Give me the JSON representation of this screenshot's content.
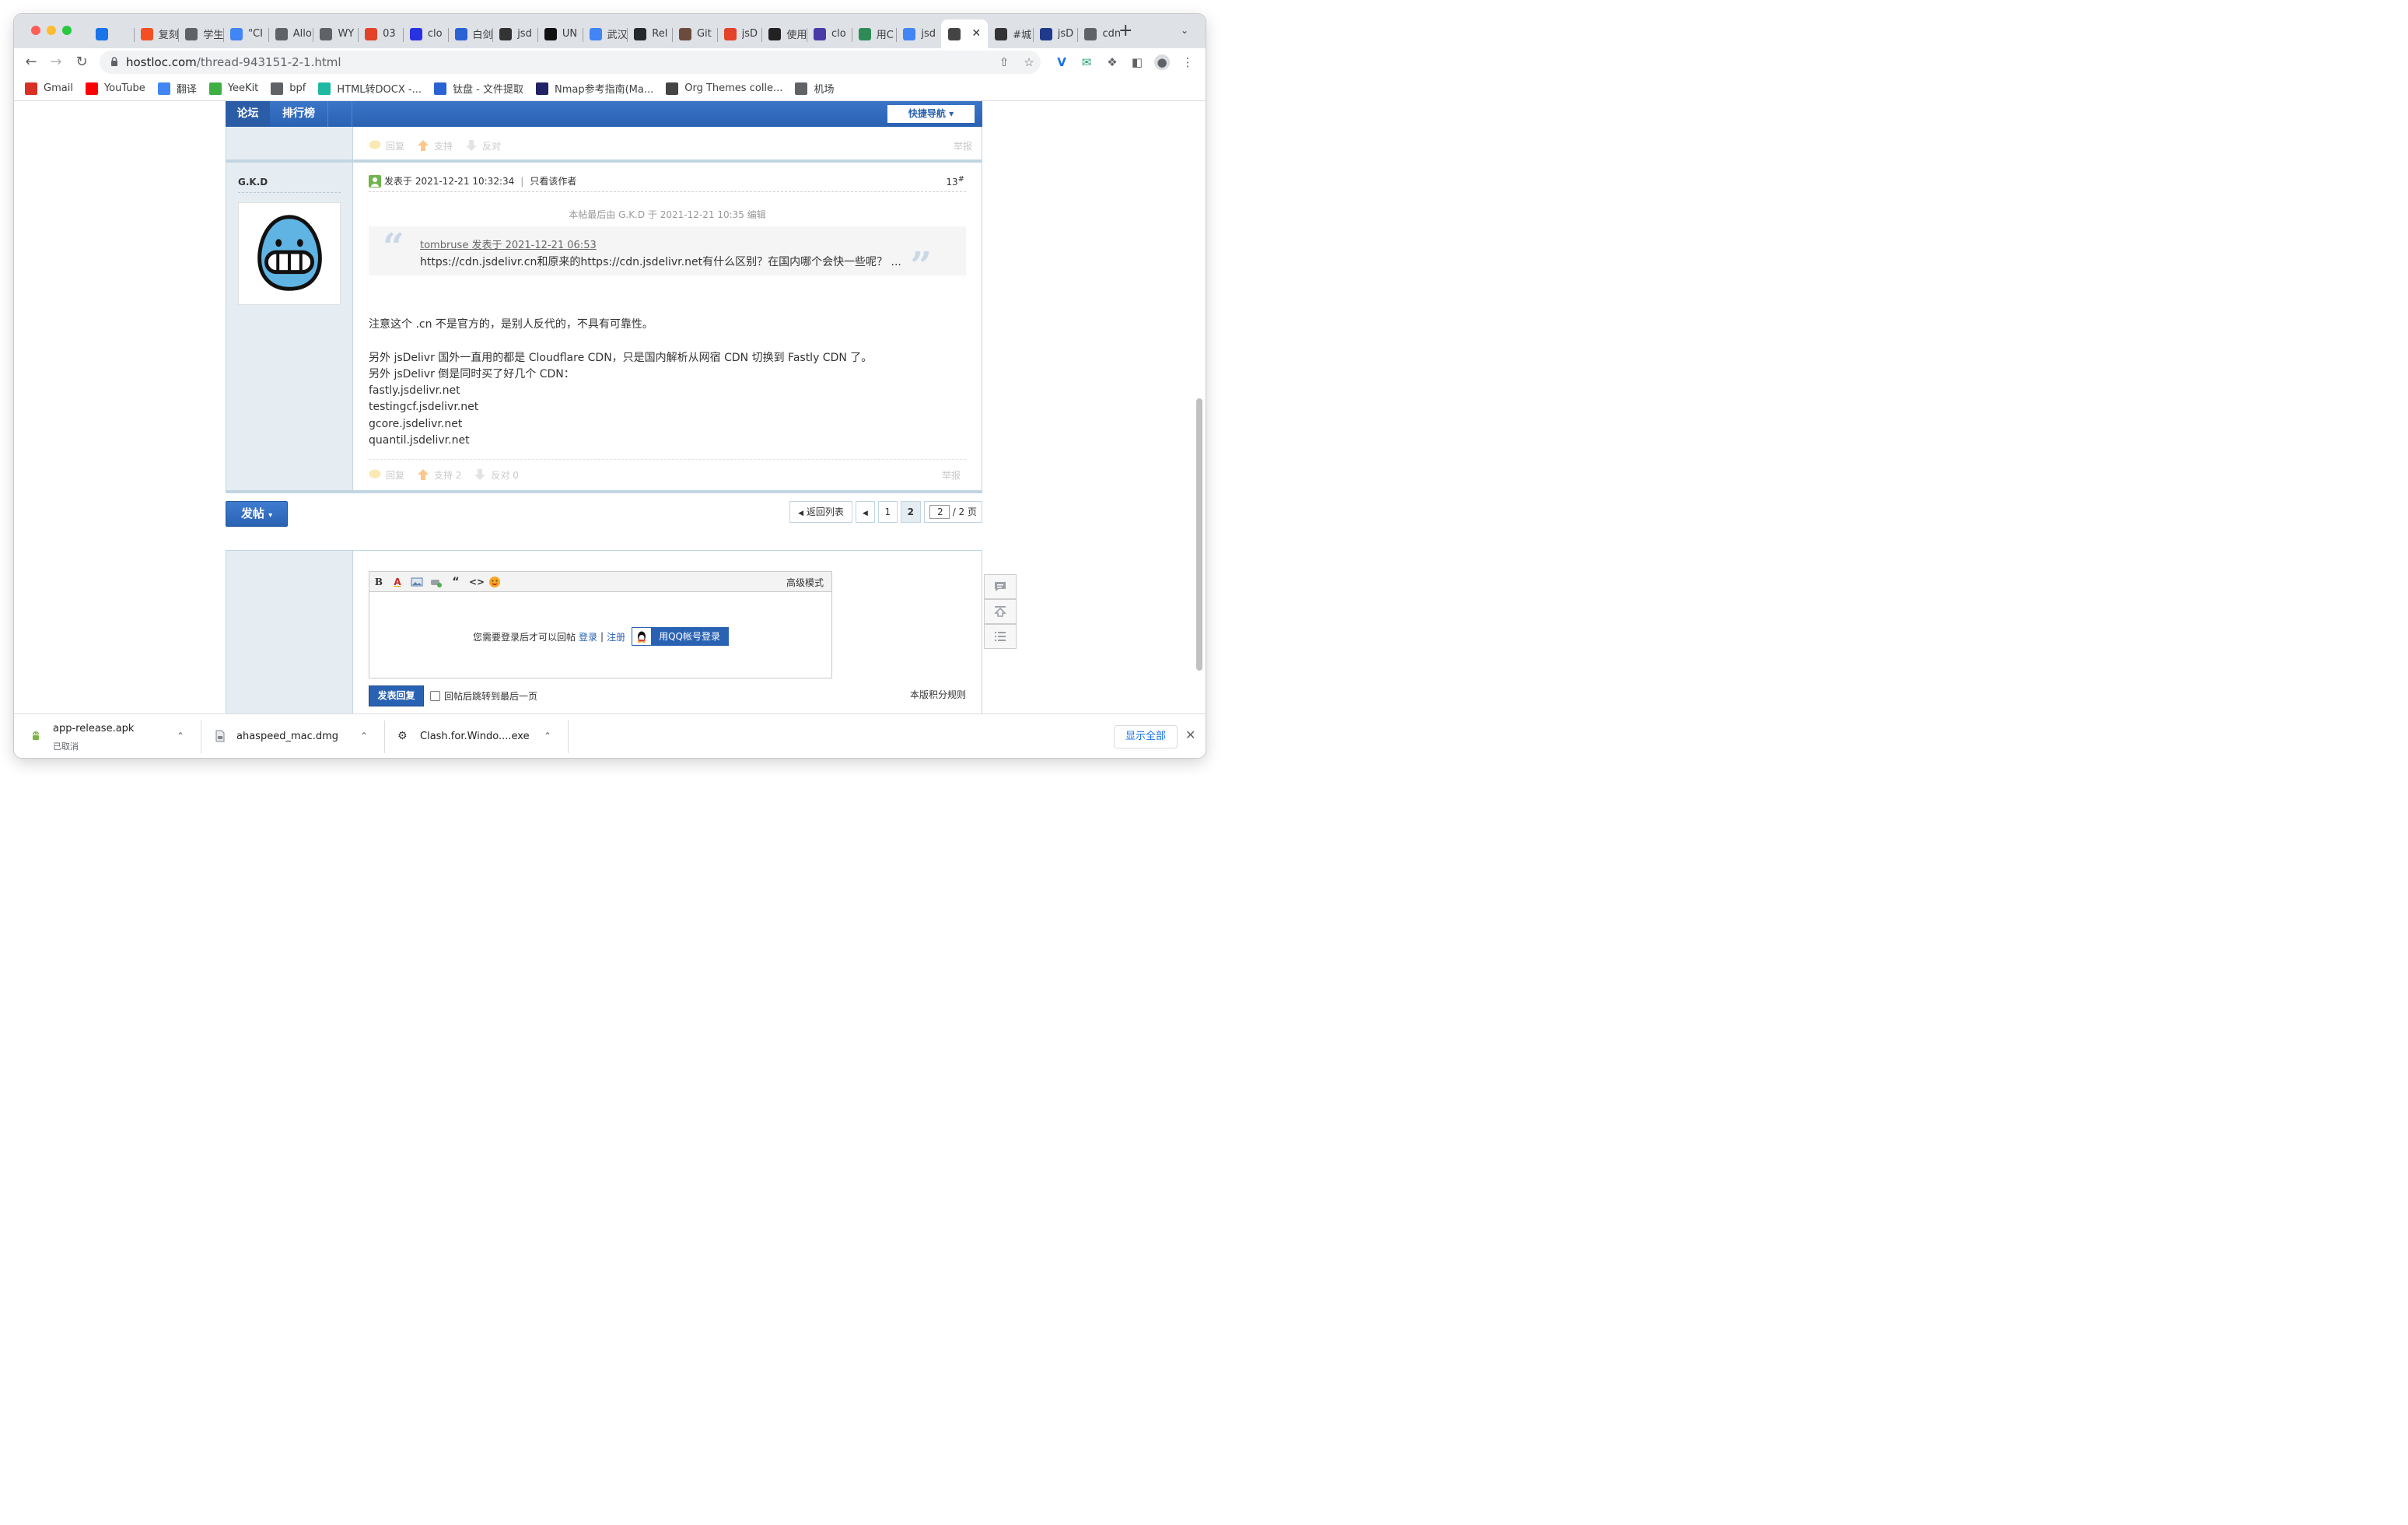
{
  "browser": {
    "tabs": [
      {
        "title": "",
        "icon": "vee-icon",
        "color": "#1a73e8"
      },
      {
        "title": "复刻",
        "icon": "windows-icon",
        "color": "#f25022"
      },
      {
        "title": "学生",
        "icon": "globe-icon",
        "color": "#5f6368"
      },
      {
        "title": "\"CI",
        "icon": "google-icon",
        "color": "#4285f4"
      },
      {
        "title": "Allo",
        "icon": "globe-icon",
        "color": "#5f6368"
      },
      {
        "title": "WY",
        "icon": "globe-icon",
        "color": "#5f6368"
      },
      {
        "title": "03",
        "icon": "shield-icon",
        "color": "#e24329"
      },
      {
        "title": "clo",
        "icon": "baidu-icon",
        "color": "#2932e1"
      },
      {
        "title": "白剑",
        "icon": "feather-icon",
        "color": "#2a62d4"
      },
      {
        "title": "jsd",
        "icon": "translate-icon",
        "color": "#333333"
      },
      {
        "title": "UN",
        "icon": "u-icon",
        "color": "#111111"
      },
      {
        "title": "武汉",
        "icon": "google-icon",
        "color": "#4285f4"
      },
      {
        "title": "Rel",
        "icon": "github-icon",
        "color": "#24292e"
      },
      {
        "title": "Git",
        "icon": "avatar-icon",
        "color": "#6b4b3e"
      },
      {
        "title": "jsD",
        "icon": "shield-icon",
        "color": "#e24329"
      },
      {
        "title": "使用",
        "icon": "avatar-icon",
        "color": "#222222"
      },
      {
        "title": "clo",
        "icon": "badge-icon",
        "color": "#4a3aa8"
      },
      {
        "title": "用C",
        "icon": "picture-icon",
        "color": "#2e8b57"
      },
      {
        "title": "jsd",
        "icon": "google-icon",
        "color": "#4285f4"
      },
      {
        "title": "",
        "icon": "owl-icon",
        "color": "#444444",
        "active": true
      },
      {
        "title": "#城",
        "icon": "cat-icon",
        "color": "#333333"
      },
      {
        "title": "jsD",
        "icon": "picture-icon",
        "color": "#1f3a8a"
      },
      {
        "title": "cdn",
        "icon": "globe-icon",
        "color": "#5f6368"
      }
    ],
    "url_host": "hostloc.com",
    "url_path": "/thread-943151-2-1.html"
  },
  "bookmarks": [
    {
      "label": "Gmail",
      "icon": "gmail-icon",
      "color": "#d93025"
    },
    {
      "label": "YouTube",
      "icon": "youtube-icon",
      "color": "#ff0000"
    },
    {
      "label": "翻译",
      "icon": "translate-icon",
      "color": "#4285f4"
    },
    {
      "label": "YeeKit",
      "icon": "yeekit-icon",
      "color": "#3cb043"
    },
    {
      "label": "bpf",
      "icon": "folder-icon",
      "color": "#5f6368"
    },
    {
      "label": "HTML转DOCX -...",
      "icon": "convert-icon",
      "color": "#1fb8a3"
    },
    {
      "label": "钛盘 - 文件提取",
      "icon": "feather-icon",
      "color": "#2a62d4"
    },
    {
      "label": "Nmap参考指南(Ma...",
      "icon": "eye-icon",
      "color": "#222266"
    },
    {
      "label": "Org Themes colle...",
      "icon": "sun-icon",
      "color": "#444444"
    },
    {
      "label": "机场",
      "icon": "folder-icon",
      "color": "#5f6368"
    }
  ],
  "forum": {
    "nav_tabs": [
      "论坛",
      "排行榜"
    ],
    "quick_nav": "快捷导航",
    "prev_actions": {
      "reply": "回复",
      "support": "支持",
      "oppose": "反对",
      "report": "举报"
    },
    "post": {
      "author": "G.K.D",
      "posted_at": "发表于 2021-12-21 10:32:34",
      "only_author": "只看该作者",
      "floor": "13",
      "floor_mark": "#",
      "edit_note": "本帖最后由 G.K.D 于 2021-12-21 10:35 编辑",
      "quote_author": "tombruse 发表于 2021-12-21 06:53",
      "quote_text": "https://cdn.jsdelivr.cn和原来的https://cdn.jsdelivr.net有什么区别？在国内哪个会快一些呢？ ...",
      "body": [
        "注意这个 .cn 不是官方的，是别人反代的，不具有可靠性。",
        "",
        "另外 jsDelivr 国外一直用的都是 Cloudflare CDN，只是国内解析从网宿 CDN 切换到 Fastly CDN 了。",
        "另外 jsDelivr 倒是同时买了好几个 CDN：",
        "fastly.jsdelivr.net",
        "testingcf.jsdelivr.net",
        "gcore.jsdelivr.net",
        "quantil.jsdelivr.net"
      ],
      "actions": {
        "reply": "回复",
        "support": "支持 2",
        "oppose": "反对 0",
        "report": "举报"
      }
    },
    "new_post_button": "发帖",
    "pager": {
      "back": "返回列表",
      "pages": [
        "1",
        "2"
      ],
      "current": "2",
      "input_value": "2",
      "total": "/ 2 页"
    },
    "reply": {
      "advanced_mode": "高级模式",
      "login_prompt": "您需要登录后才可以回帖",
      "login": "登录",
      "separator": "|",
      "register": "注册",
      "qq_login": "用QQ帐号登录",
      "submit": "发表回复",
      "jump_last": "回帖后跳转到最后一页",
      "rules": "本版积分规则"
    }
  },
  "downloads": {
    "items": [
      {
        "name": "app-release.apk",
        "status": "已取消",
        "icon": "android-icon"
      },
      {
        "name": "ahaspeed_mac.dmg",
        "status": "",
        "icon": "file-icon"
      },
      {
        "name": "Clash.for.Windo....exe",
        "status": "",
        "icon": "gear-icon"
      }
    ],
    "show_all": "显示全部"
  },
  "colors": {
    "forum_blue": "#2a62b3",
    "forum_light": "#e5edf2",
    "border": "#c2d5e3"
  }
}
